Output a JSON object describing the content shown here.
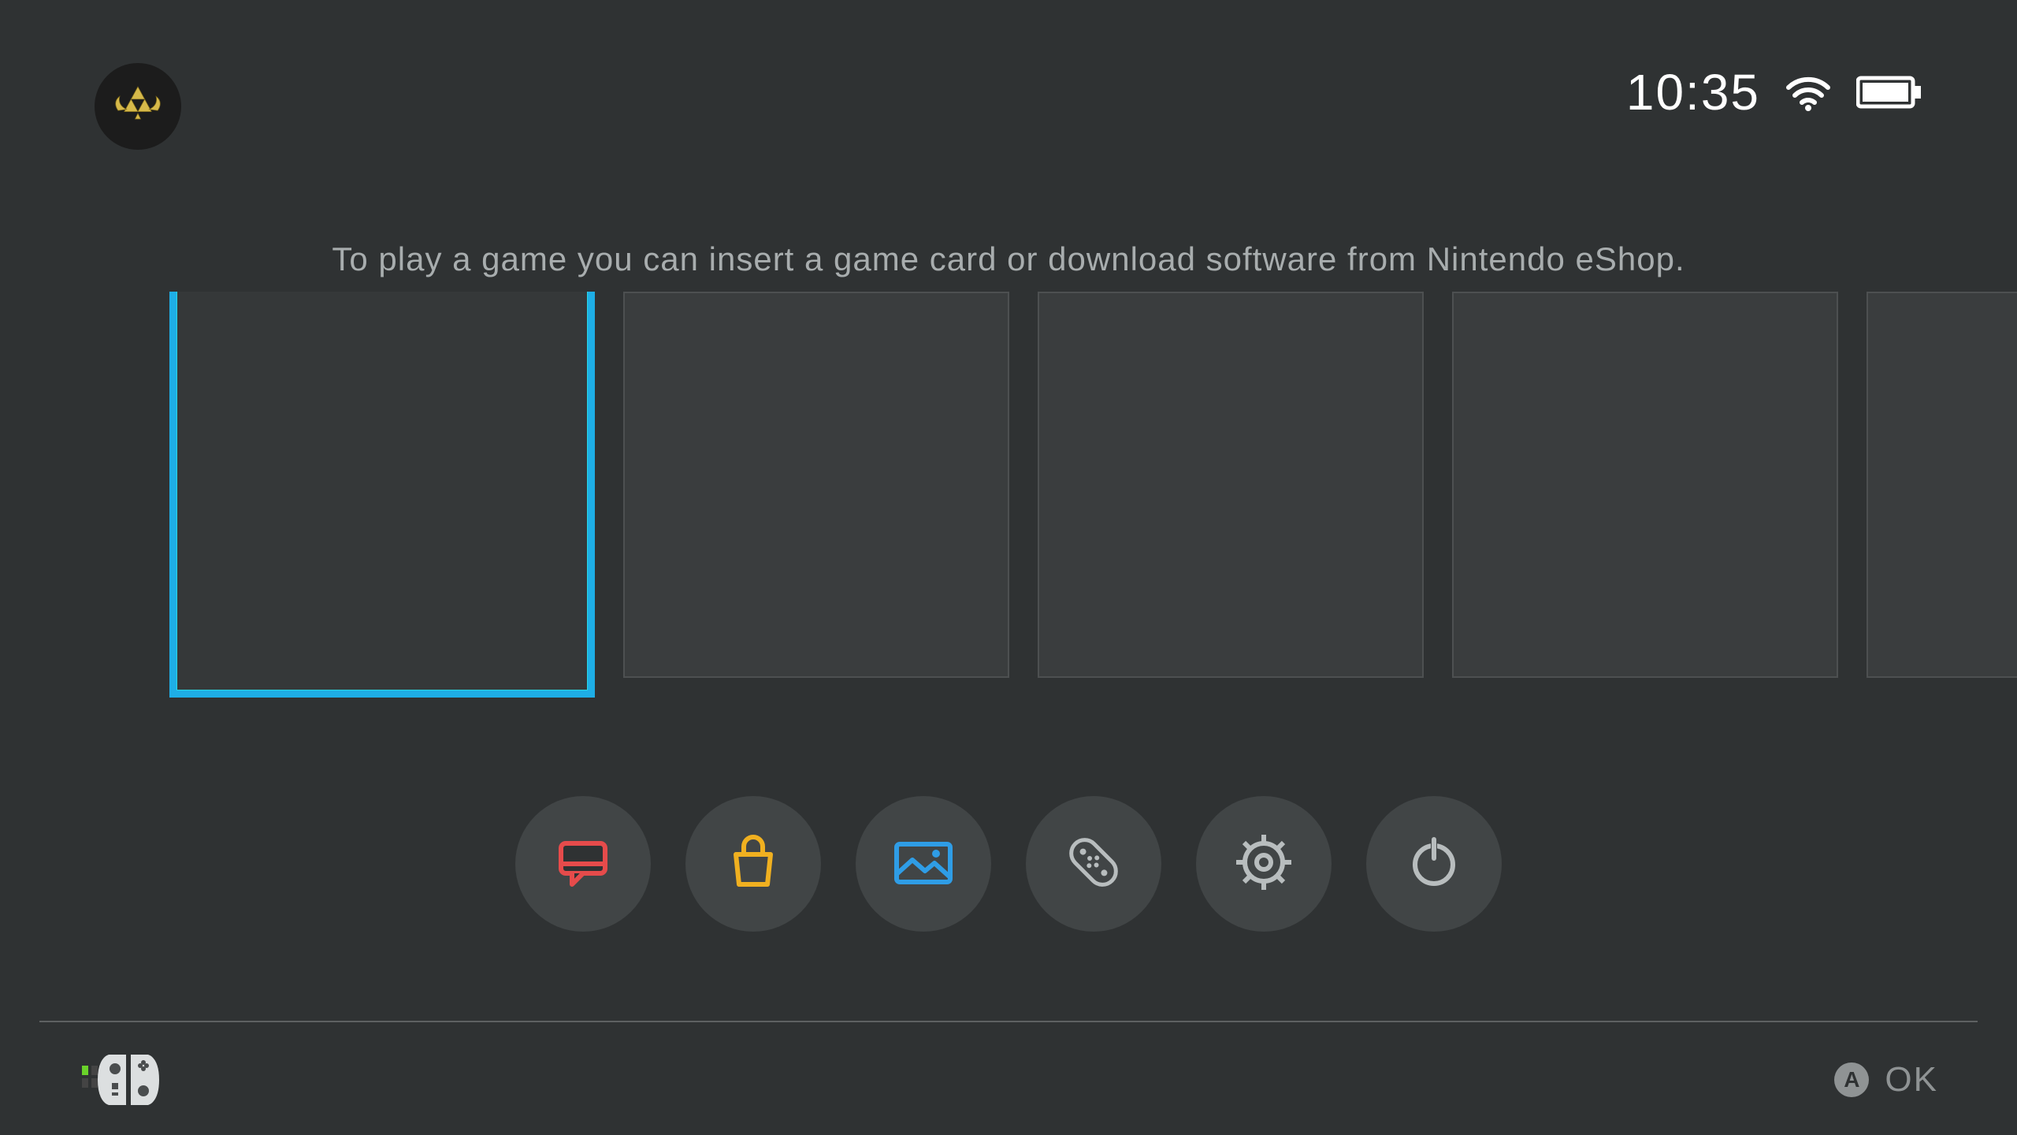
{
  "status": {
    "time": "10:35",
    "wifi_strength": 3,
    "battery_level": "full"
  },
  "user": {
    "avatar_name": "triforce-crest"
  },
  "hint_text": "To play a game you can insert a game card or download software from Nintendo eShop.",
  "tiles": [
    {
      "selected": true,
      "empty": true
    },
    {
      "selected": false,
      "empty": true
    },
    {
      "selected": false,
      "empty": true
    },
    {
      "selected": false,
      "empty": true
    },
    {
      "selected": false,
      "empty": true
    }
  ],
  "dock": [
    {
      "name": "news",
      "color": "#e64b4b"
    },
    {
      "name": "eshop",
      "color": "#f0b020"
    },
    {
      "name": "album",
      "color": "#2f9de6"
    },
    {
      "name": "controllers",
      "color": "#b8bdbe"
    },
    {
      "name": "settings",
      "color": "#b8bdbe"
    },
    {
      "name": "power",
      "color": "#b8bdbe"
    }
  ],
  "footer": {
    "controller_connected": true,
    "ok_button_glyph": "A",
    "ok_label": "OK"
  },
  "colors": {
    "bg": "#2f3233",
    "tile": "#3a3d3e",
    "highlight": "#1eaee6"
  }
}
